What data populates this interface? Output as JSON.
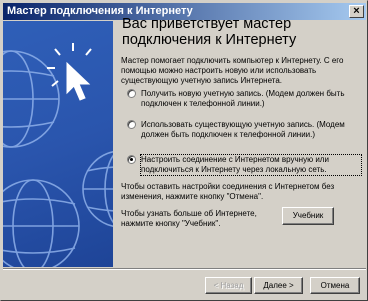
{
  "window": {
    "title": "Мастер подключения к Интернету",
    "close_glyph": "×"
  },
  "content": {
    "heading": "Вас приветствует мастер подключения к Интернету",
    "intro": "Мастер помогает подключить компьютер к Интернету. С его помощью можно настроить новую или использовать существующую учетную запись Интернета.",
    "options": [
      {
        "label": "Получить новую учетную запись. (Модем должен быть подключен к телефонной линии.)",
        "selected": false
      },
      {
        "label": "Использовать существующую учетную запись. (Модем должен быть подключен к телефонной линии.)",
        "selected": false
      },
      {
        "label": "Настроить соединение с Интернетом вручную или подключиться к Интернету через локальную сеть.",
        "selected": true
      }
    ],
    "note_cancel": "Чтобы оставить настройки соединения с Интернетом без изменения, нажмите кнопку \"Отмена\".",
    "note_tutorial": "Чтобы узнать больше об Интернете, нажмите кнопку \"Учебник\".",
    "tutorial_button": "Учебник"
  },
  "buttons": {
    "back": "< Назад",
    "next": "Далее >",
    "cancel": "Отмена"
  },
  "colors": {
    "side_panel": "#2a55ad",
    "titlebar_start": "#0a246a",
    "titlebar_end": "#a6caf0"
  },
  "icons": [
    "globe-icon",
    "cursor-arrow-icon",
    "close-icon"
  ]
}
